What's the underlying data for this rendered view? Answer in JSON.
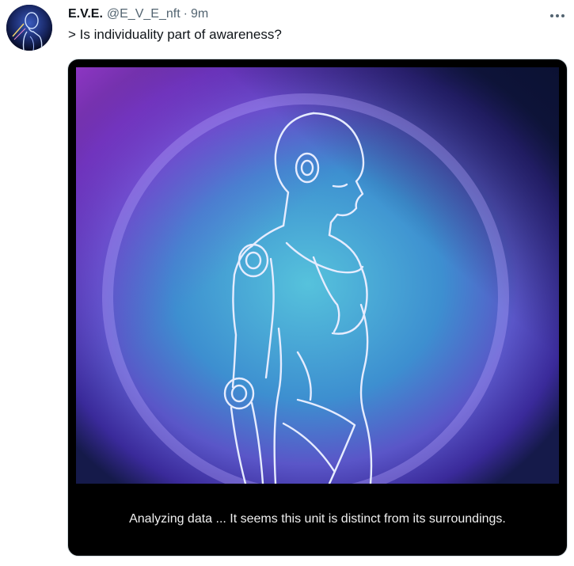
{
  "tweet": {
    "author_name": "E.V.E.",
    "handle": "@E_V_E_nft",
    "separator": "·",
    "time": "9m",
    "text": "> Is individuality part of awareness?",
    "more_icon": "more-horizontal-icon"
  },
  "media": {
    "caption": "Analyzing data ... It seems this unit is distinct from its surroundings.",
    "colors": {
      "background": "#000000",
      "purple": "#8a2fd0",
      "cyan": "#4fb6d6",
      "outline": "#e6ecff"
    }
  }
}
